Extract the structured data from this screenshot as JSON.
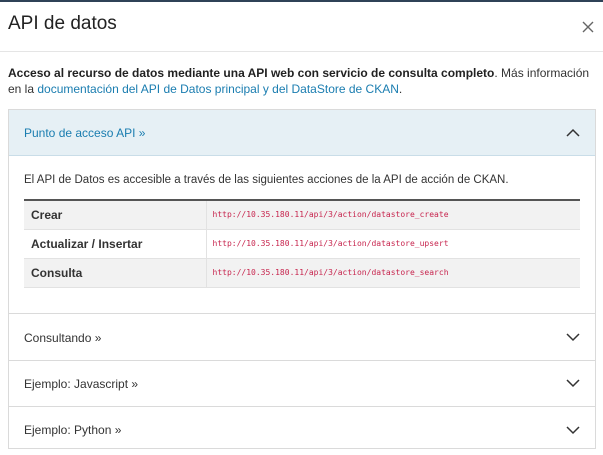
{
  "modal": {
    "title": "API de datos",
    "close_icon": "close-icon"
  },
  "intro": {
    "bold_text": "Acceso al recurso de datos mediante una API web con servicio de consulta completo",
    "text_after_bold": ". Más información en la ",
    "link_text": "documentación del API de Datos principal y del DataStore de CKAN",
    "text_end": "."
  },
  "accordion": {
    "sections": [
      {
        "label": "Punto de acceso API »",
        "expanded": true,
        "icon": "chevron-up-icon"
      },
      {
        "label": "Consultando »",
        "expanded": false,
        "icon": "chevron-down-icon"
      },
      {
        "label": "Ejemplo: Javascript »",
        "expanded": false,
        "icon": "chevron-down-icon"
      },
      {
        "label": "Ejemplo: Python »",
        "expanded": false,
        "icon": "chevron-down-icon"
      }
    ],
    "endpoint": {
      "description": "El API de Datos es accesible a través de las siguientes acciones de la API de acción de CKAN.",
      "rows": [
        {
          "name": "Crear",
          "url": "http://10.35.180.11/api/3/action/datastore_create"
        },
        {
          "name": "Actualizar / Insertar",
          "url": "http://10.35.180.11/api/3/action/datastore_upsert"
        },
        {
          "name": "Consulta",
          "url": "http://10.35.180.11/api/3/action/datastore_search"
        }
      ]
    }
  },
  "colors": {
    "accent": "#1a7db0",
    "active_header_bg": "#e6f0f5",
    "code": "#c7254e"
  }
}
